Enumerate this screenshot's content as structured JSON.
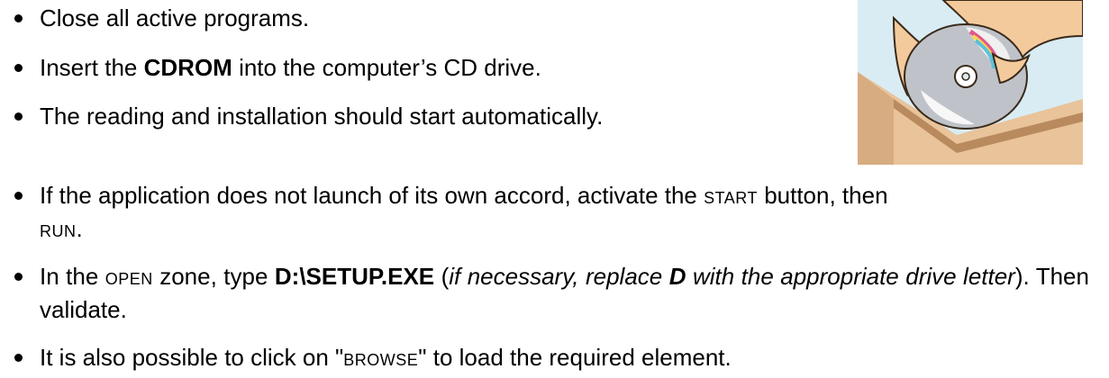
{
  "steps": [
    {
      "text": "Close all active programs."
    },
    {
      "prefix": "Insert the ",
      "strong": "CDROM",
      "suffix": " into the computer’s CD drive."
    },
    {
      "text": "The reading and installation should start automatically."
    },
    {
      "a": "If the application does not launch of its own accord, activate the ",
      "start_label": "START",
      "b": " button, then",
      "run_label": "RUN",
      "c": "."
    },
    {
      "a": "In the ",
      "open_label": "OPEN",
      "b": " zone, type ",
      "command": "D:\\SETUP.EXE",
      "c": " (",
      "note_a": "if necessary, replace ",
      "note_drive": "D",
      "note_b": " with the appropriate drive letter",
      "d": "). Then validate."
    },
    {
      "a": "It is also possible to click on \"",
      "browse_label": "BROWSE",
      "b": "\" to load the required element."
    }
  ],
  "illustration": {
    "icon": "cd-insert-illustration",
    "colors": {
      "skin": "#f3ca9c",
      "bg": "#d9ecf4",
      "disc": "#bfc3c9",
      "outline": "#3a2a1a"
    }
  }
}
